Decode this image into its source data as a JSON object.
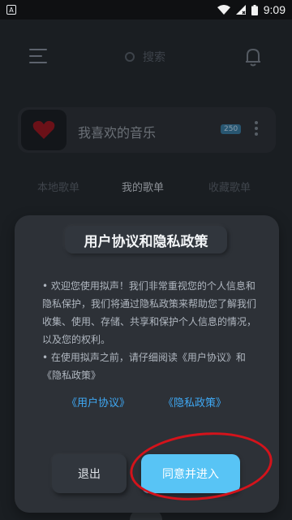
{
  "status_bar": {
    "time": "9:09",
    "notification_glyph": "A"
  },
  "background": {
    "search_placeholder": "搜索",
    "favorites_title": "我喜欢的音乐",
    "favorites_badge": "250",
    "tabs": [
      {
        "label": "本地歌单"
      },
      {
        "label": "我的歌单"
      },
      {
        "label": "收藏歌单"
      }
    ]
  },
  "dialog": {
    "title": "用户协议和隐私政策",
    "paragraphs": [
      "• 欢迎您使用拟声！我们非常重视您的个人信息和隐私保护，我们将通过隐私政策来帮助您了解我们收集、使用、存储、共享和保护个人信息的情况，以及您的权利。",
      "• 在使用拟声之前，请仔细阅读《用户协议》和《隐私政策》"
    ],
    "link_user_agreement": "《用户协议》",
    "link_privacy_policy": "《隐私政策》",
    "exit_button": "退出",
    "agree_button": "同意并进入"
  },
  "colors": {
    "accent": "#58c4f5",
    "link": "#3fa9f5",
    "highlight": "#d4131b"
  }
}
